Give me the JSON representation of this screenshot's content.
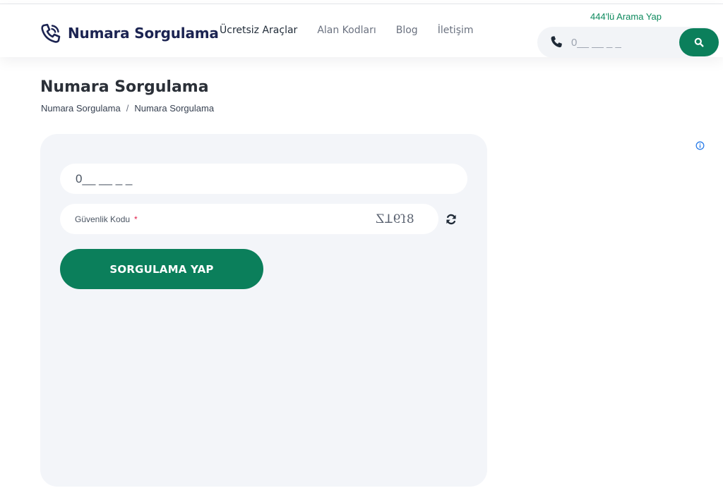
{
  "header": {
    "logo_text": "Numara Sorgulama",
    "nav": [
      {
        "label": "Ücretsiz Araçlar"
      },
      {
        "label": "Alan Kodları"
      },
      {
        "label": "Blog"
      },
      {
        "label": "İletişim"
      }
    ],
    "call_link": "444'lü Arama Yap",
    "search": {
      "placeholder": "0__ __ _ _",
      "phone_icon": "phone-icon",
      "button_icon": "search-icon"
    }
  },
  "page": {
    "title": "Numara Sorgulama",
    "breadcrumb": [
      "Numara Sorgulama",
      "Numara Sorgulama"
    ],
    "breadcrumb_sep": "/"
  },
  "form": {
    "phone_placeholder": "0__ __ _ _",
    "captcha_label": "Güvenlik Kodu",
    "captcha_required_mark": "*",
    "captcha_code": "8ſ9ꓕZ",
    "refresh_icon": "refresh-icon",
    "submit_label": "SORGULAMA YAP"
  },
  "ad": {
    "icon": "info-icon"
  },
  "colors": {
    "brand_green": "#0b7f5b",
    "link_green": "#0e8a5e",
    "logo_navy": "#1c2452",
    "card_bg": "#f3f5f9",
    "required_red": "#e11d48"
  }
}
